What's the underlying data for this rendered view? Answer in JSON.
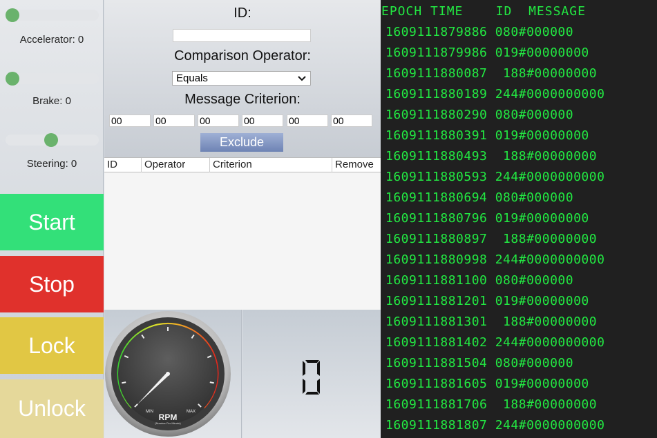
{
  "controls": {
    "accelerator_label": "Accelerator: 0",
    "accelerator_value": 0,
    "brake_label": "Brake: 0",
    "brake_value": 0,
    "steering_label": "Steering: 0",
    "steering_value": 0,
    "start_label": "Start",
    "stop_label": "Stop",
    "lock_label": "Lock",
    "unlock_label": "Unlock",
    "colors": {
      "start": "#33e079",
      "stop": "#e0312c",
      "lock": "#e1c744",
      "unlock": "#e5d89a"
    }
  },
  "filter": {
    "id_label": "ID:",
    "id_value": "",
    "operator_label": "Comparison Operator:",
    "operator_selected": "Equals",
    "criterion_label": "Message Criterion:",
    "criterion_bytes": [
      "00",
      "00",
      "00",
      "00",
      "00",
      "00"
    ],
    "exclude_label": "Exclude"
  },
  "filter_table": {
    "columns": [
      "ID",
      "Operator",
      "Criterion",
      "Remove"
    ],
    "rows": []
  },
  "gauge": {
    "label": "RPM",
    "sublabel": "(Number Per Minute)",
    "min_label": "MIN",
    "max_label": "MAX",
    "value_fraction": 0.0
  },
  "digit_display": {
    "value": "0"
  },
  "log": {
    "header": "EPOCH TIME    ID  MESSAGE",
    "rows": [
      "1609111879886 080#000000",
      "1609111879986 019#00000000",
      "1609111880087  188#00000000",
      "1609111880189 244#0000000000",
      "1609111880290 080#000000",
      "1609111880391 019#00000000",
      "1609111880493  188#00000000",
      "1609111880593 244#0000000000",
      "1609111880694 080#000000",
      "1609111880796 019#00000000",
      "1609111880897  188#00000000",
      "1609111880998 244#0000000000",
      "1609111881100 080#000000",
      "1609111881201 019#00000000",
      "1609111881301  188#00000000",
      "1609111881402 244#0000000000",
      "1609111881504 080#000000",
      "1609111881605 019#00000000",
      "1609111881706  188#00000000",
      "1609111881807 244#0000000000"
    ],
    "text_color": "#22e842",
    "background": "#202020"
  }
}
